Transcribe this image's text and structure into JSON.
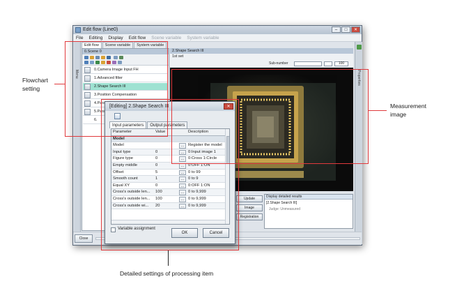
{
  "window": {
    "title": "Edit flow (Line0)",
    "menu": [
      "File",
      "Editing",
      "Display",
      "Edit flow",
      "Scene variable",
      "System variable"
    ],
    "tabs": [
      "Edit flow",
      "Scene variable",
      "System variable"
    ],
    "left_strip_label": "Menu",
    "right_strip_label": "Properties",
    "close_label": "Close"
  },
  "flow_panel": {
    "header": "0.Scene 0",
    "items": [
      {
        "label": "0.Camera Image Input FH",
        "selected": false
      },
      {
        "label": "1.Advanced filter",
        "selected": false
      },
      {
        "label": "2.Shape Search III",
        "selected": true
      },
      {
        "label": "3.Position Compensation",
        "selected": false
      },
      {
        "label": "4.Parallel",
        "selected": false
      },
      {
        "label": "5.Parallel",
        "selected": false
      },
      {
        "label": "6.",
        "selected": false
      }
    ]
  },
  "right_panel": {
    "header": "2.Shape Search III",
    "set_label": "1st set",
    "display_label": "Sub-number",
    "display_value": "100"
  },
  "results": {
    "buttons": [
      "Update",
      "Image",
      "Registration"
    ],
    "list_header": "Display detailed results",
    "line1": "[2.Shape Search III]",
    "line2": "Judge: Unmeasured"
  },
  "dialog": {
    "title": "[Editing] 2.Shape Search III",
    "tabs": [
      "Input parameters",
      "Output parameters"
    ],
    "columns": [
      "Parameter",
      "Value",
      "Description"
    ],
    "group": "Model",
    "rows": [
      {
        "param": "Model",
        "value": "",
        "desc": "Register the model"
      },
      {
        "param": "Input type",
        "value": "0",
        "desc": "0:Input image 1"
      },
      {
        "param": "Figure type",
        "value": "0",
        "desc": "0:Cross 1:Circle"
      },
      {
        "param": "Empty middle",
        "value": "0",
        "desc": "0:OFF 1:ON"
      },
      {
        "param": "Offset",
        "value": "5",
        "desc": "0 to 99"
      },
      {
        "param": "Smooth count",
        "value": "1",
        "desc": "0 to 9"
      },
      {
        "param": "Equal XY",
        "value": "0",
        "desc": "0:OFF 1:ON"
      },
      {
        "param": "Cross's outside len...",
        "value": "100",
        "desc": "0 to 9,999"
      },
      {
        "param": "Cross's outside len...",
        "value": "100",
        "desc": "0 to 9,999"
      },
      {
        "param": "Cross's outside wi...",
        "value": "20",
        "desc": "0 to 9,999"
      }
    ],
    "ellipsis": "...",
    "checkbox_label": "Variable assignment",
    "ok_label": "OK",
    "cancel_label": "Cancel"
  },
  "annotations": {
    "flowchart": [
      "Flowchart",
      "setting"
    ],
    "measurement": [
      "Measurement",
      "image"
    ],
    "detailed": "Detailed settings of processing item"
  },
  "colors": {
    "highlight": "#e0393c",
    "selected_item": "#9ee2d2",
    "titlebar": "#c4cfdb"
  }
}
